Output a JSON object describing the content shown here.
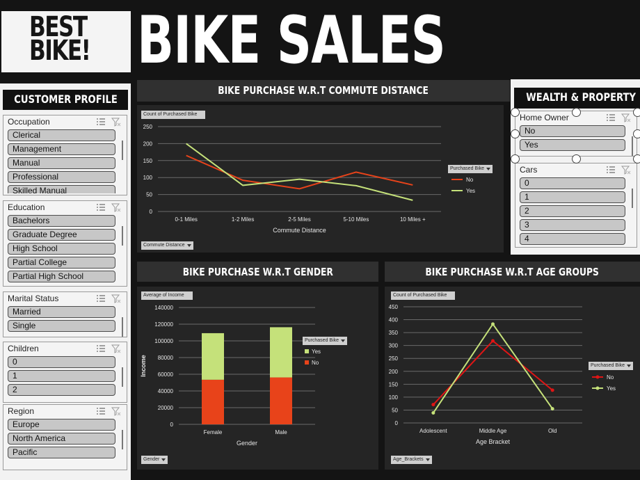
{
  "header": {
    "logo_line1": "BEST",
    "logo_line2": "BIKE!",
    "title": "BIKE SALES"
  },
  "customer_profile": {
    "title": "CUSTOMER PROFILE",
    "slicers": [
      {
        "id": "occupation",
        "title": "Occupation",
        "items": [
          "Clerical",
          "Management",
          "Manual",
          "Professional",
          "Skilled Manual"
        ]
      },
      {
        "id": "education",
        "title": "Education",
        "items": [
          "Bachelors",
          "Graduate Degree",
          "High School",
          "Partial College",
          "Partial High School"
        ]
      },
      {
        "id": "marital",
        "title": "Marital Status",
        "items": [
          "Married",
          "Single"
        ]
      },
      {
        "id": "children",
        "title": "Children",
        "items": [
          "0",
          "1",
          "2"
        ]
      },
      {
        "id": "region",
        "title": "Region",
        "items": [
          "Europe",
          "North America",
          "Pacific"
        ]
      }
    ]
  },
  "wealth": {
    "title": "WEALTH & PROPERTY",
    "slicers": [
      {
        "id": "home",
        "title": "Home Owner",
        "items": [
          "No",
          "Yes"
        ]
      },
      {
        "id": "cars",
        "title": "Cars",
        "items": [
          "0",
          "1",
          "2",
          "3",
          "4"
        ]
      }
    ]
  },
  "colors": {
    "no": "#e8431a",
    "yes": "#c5e17a",
    "age_no": "#e01515",
    "age_yes": "#c5e17a",
    "panel_bg": "#252525",
    "header_bg": "#303030"
  },
  "charts": {
    "commute": {
      "title": "BIKE PURCHASE W.R.T COMMUTE DISTANCE",
      "value_field": "Count of Purchased Bike",
      "axis_field": "Commute Distance",
      "legend_field": "Purchased Bike"
    },
    "gender": {
      "title": "BIKE PURCHASE W.R.T GENDER",
      "value_field": "Average of Income",
      "axis_field": "Gender",
      "legend_field": "Purchased Bike"
    },
    "age": {
      "title": "BIKE PURCHASE W.R.T AGE GROUPS",
      "value_field": "Count of Purchased Bike",
      "axis_field": "Age_Brackets",
      "legend_field": "Purchased Bike"
    }
  },
  "chart_data": [
    {
      "type": "line",
      "categories": [
        "0-1 Miles",
        "1-2 Miles",
        "2-5 Miles",
        "5-10 Miles",
        "10 Miles +"
      ],
      "series": [
        {
          "name": "No",
          "values": [
            165,
            92,
            67,
            116,
            78
          ]
        },
        {
          "name": "Yes",
          "values": [
            200,
            77,
            95,
            76,
            33
          ]
        }
      ],
      "xlabel": "Commute Distance",
      "ylabel": "",
      "yticks": [
        0,
        50,
        100,
        150,
        200,
        250
      ],
      "ylim": [
        0,
        250
      ],
      "grid": true,
      "legend": "right"
    },
    {
      "type": "bar",
      "stacked": true,
      "categories": [
        "Female",
        "Male"
      ],
      "series": [
        {
          "name": "No",
          "values": [
            53450,
            56209
          ]
        },
        {
          "name": "Yes",
          "values": [
            55774,
            60124
          ]
        }
      ],
      "xlabel": "Gender",
      "ylabel": "Income",
      "yticks": [
        0,
        20000,
        40000,
        60000,
        80000,
        100000,
        120000,
        140000
      ],
      "ylim": [
        0,
        140000
      ],
      "grid": true,
      "legend": "right"
    },
    {
      "type": "line",
      "markers": true,
      "categories": [
        "Adolescent",
        "Middle Age",
        "Old"
      ],
      "series": [
        {
          "name": "No",
          "values": [
            71,
            318,
            127
          ]
        },
        {
          "name": "Yes",
          "values": [
            39,
            383,
            55
          ]
        }
      ],
      "xlabel": "Age Bracket",
      "ylabel": "",
      "yticks": [
        0,
        50,
        100,
        150,
        200,
        250,
        300,
        350,
        400,
        450
      ],
      "ylim": [
        0,
        450
      ],
      "grid": true,
      "legend": "right"
    }
  ]
}
